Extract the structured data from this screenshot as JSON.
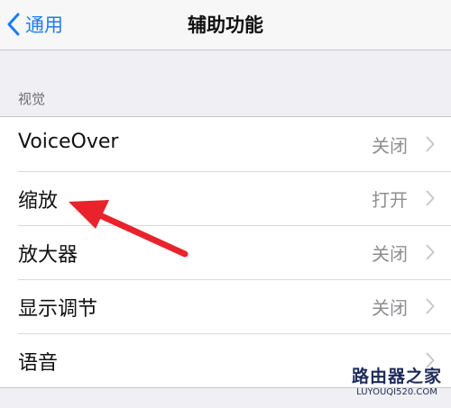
{
  "navbar": {
    "back_label": "通用",
    "title": "辅助功能"
  },
  "section": {
    "header": "视觉"
  },
  "rows": [
    {
      "label": "VoiceOver",
      "value": "关闭"
    },
    {
      "label": "缩放",
      "value": "打开"
    },
    {
      "label": "放大器",
      "value": "关闭"
    },
    {
      "label": "显示调节",
      "value": "关闭"
    },
    {
      "label": "语音",
      "value": ""
    }
  ],
  "watermark": {
    "site_name": "路由器之家",
    "url": "LUYOUQI520.COM"
  },
  "colors": {
    "accent": "#1d7bf5",
    "annotation_arrow": "#e8232c",
    "background": "#efeff4"
  }
}
